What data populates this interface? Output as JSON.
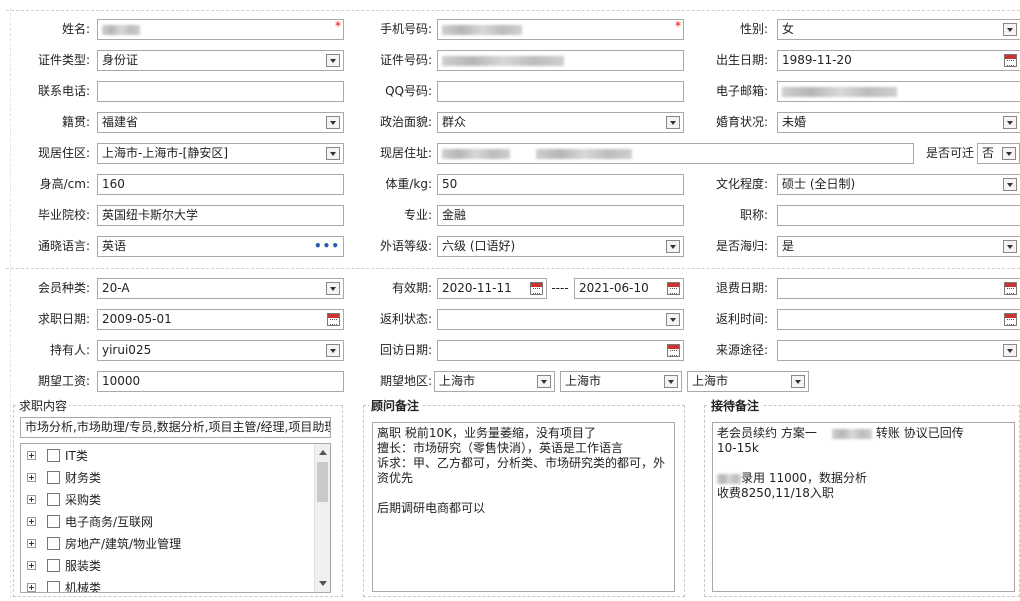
{
  "personal": {
    "name_label": "姓名:",
    "mobile_label": "手机号码:",
    "gender_label": "性别:",
    "gender_value": "女",
    "idtype_label": "证件类型:",
    "idtype_value": "身份证",
    "idno_label": "证件号码:",
    "birth_label": "出生日期:",
    "birth_value": "1989-11-20",
    "phone_label": "联系电话:",
    "phone_value": "",
    "qq_label": "QQ号码:",
    "qq_value": "",
    "email_label": "电子邮箱:",
    "native_label": "籍贯:",
    "native_value": "福建省",
    "political_label": "政治面貌:",
    "political_value": "群众",
    "marital_label": "婚育状况:",
    "marital_value": "未婚",
    "region_label": "现居住区:",
    "region_value": "上海市-上海市-[静安区]",
    "address_label": "现居住址:",
    "relocate_label": "是否可迁",
    "relocate_value": "否",
    "height_label": "身高/cm:",
    "height_value": "160",
    "weight_label": "体重/kg:",
    "weight_value": "50",
    "education_label": "文化程度:",
    "education_value": "硕士 (全日制)",
    "school_label": "毕业院校:",
    "school_value": "英国纽卡斯尔大学",
    "major_label": "专业:",
    "major_value": "金融",
    "title_label": "职称:",
    "title_value": "",
    "language_label": "通晓语言:",
    "language_value": "英语",
    "language_more": "•••",
    "foreign_level_label": "外语等级:",
    "foreign_level_value": "六级 (口语好)",
    "overseas_label": "是否海归:",
    "overseas_value": "是",
    "required_mark": "*"
  },
  "member": {
    "type_label": "会员种类:",
    "type_value": "20-A",
    "validity_label": "有效期:",
    "validity_from": "2020-11-11",
    "validity_sep": "----",
    "validity_to": "2021-06-10",
    "refund_label": "退费日期:",
    "refund_value": "",
    "job_date_label": "求职日期:",
    "job_date_value": "2009-05-01",
    "rebate_status_label": "返利状态:",
    "rebate_status_value": "",
    "rebate_time_label": "返利时间:",
    "rebate_time_value": "",
    "holder_label": "持有人:",
    "holder_value": "yirui025",
    "visit_label": "回访日期:",
    "visit_value": "",
    "source_label": "来源途径:",
    "source_value": "",
    "salary_label": "期望工资:",
    "salary_value": "10000",
    "area_label": "期望地区:",
    "area_province": "上海市",
    "area_city": "上海市",
    "area_district": "上海市"
  },
  "job": {
    "legend": "求职内容",
    "summary": "市场分析,市场助理/专员,数据分析,项目主管/经理,项目助理",
    "categories": [
      "IT类",
      "财务类",
      "采购类",
      "电子商务/互联网",
      "房地产/建筑/物业管理",
      "服装类",
      "机械类"
    ]
  },
  "consultant": {
    "legend": "顾问备注",
    "note": "离职 税前10K，业务量萎缩，没有项目了\n擅长：市场研究（零售快消），英语是工作语言\n诉求：甲、乙方都可，分析类、市场研究类的都可，外资优先\n\n后期调研电商都可以"
  },
  "reception": {
    "legend": "接待备注",
    "line1_a": "老会员续约   方案一",
    "line1_b": "转账 协议已回传",
    "line2": "10-15k",
    "line3_b": "录用  11000，数据分析",
    "line4": "收费8250,11/18入职"
  }
}
